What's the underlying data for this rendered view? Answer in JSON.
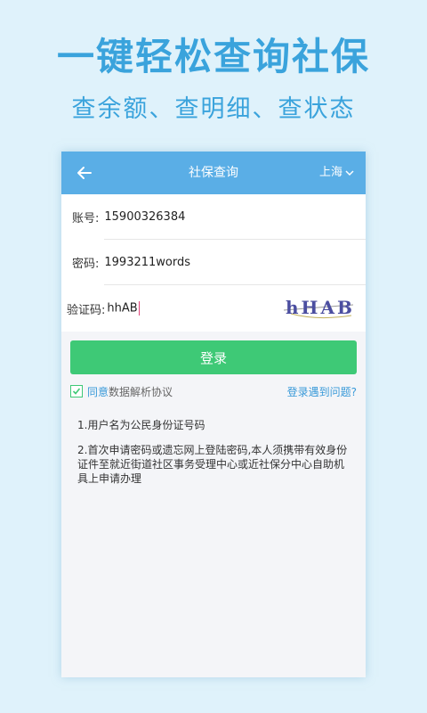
{
  "promo": {
    "headline": "一键轻松查询社保",
    "subline": "查余额、查明细、查状态"
  },
  "appbar": {
    "title": "社保查询",
    "city": "上海",
    "icons": {
      "back": "back-arrow-icon",
      "city_dropdown": "chevron-down-icon"
    }
  },
  "form": {
    "account_label": "账号:",
    "account_value": "15900326384",
    "password_label": "密码:",
    "password_value": "1993211words",
    "captcha_label": "验证码:",
    "captcha_value": "hhAB",
    "captcha_image_text": "hHAB"
  },
  "login_label": "登录",
  "agreement": {
    "checked": true,
    "prefix": "同意",
    "link": "数据解析协议",
    "problem_link": "登录遇到问题?"
  },
  "notes": [
    "1.用户名为公民身份证号码",
    "2.首次申请密码或遗忘网上登陆密码,本人须携带有效身份证件至就近街道社区事务受理中心或近社保分中心自助机具上申请办理"
  ],
  "colors": {
    "appbar": "#5aaee6",
    "promo_text": "#3aa3dc",
    "login_button": "#3ec976",
    "link": "#3a9ad9"
  }
}
